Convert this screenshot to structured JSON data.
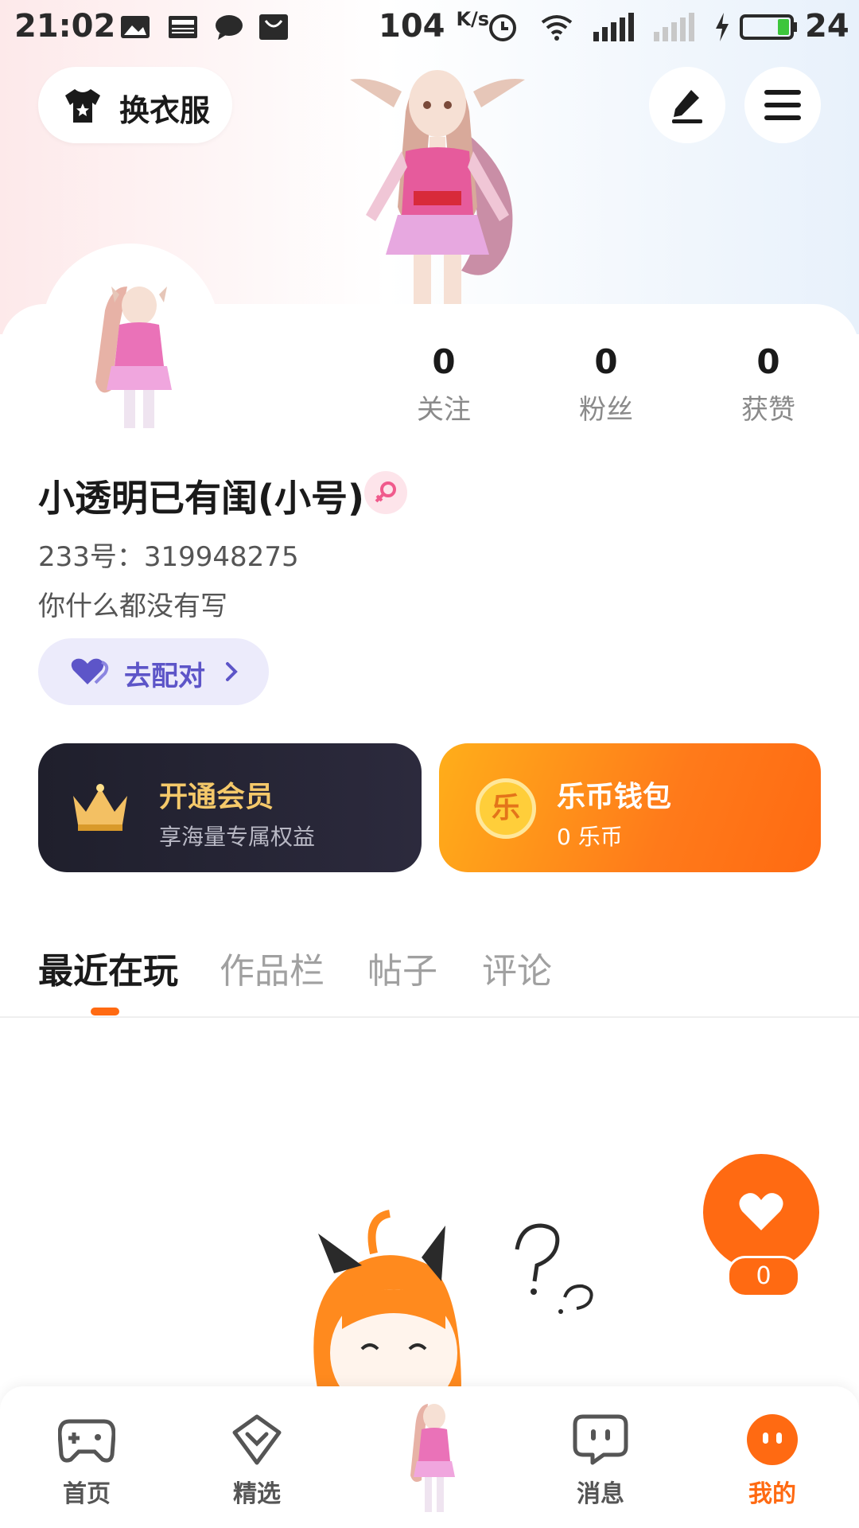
{
  "status_bar": {
    "time": "21:02",
    "speed": "104",
    "speed_unit": "K/s",
    "battery_pct": "24"
  },
  "header": {
    "change_outfit_label": "换衣服"
  },
  "profile": {
    "stats": [
      {
        "value": "0",
        "label": "关注"
      },
      {
        "value": "0",
        "label": "粉丝"
      },
      {
        "value": "0",
        "label": "获赞"
      }
    ],
    "username": "小透明已有闺(小号)",
    "uid": "233号：319948275",
    "bio": "你什么都没有写",
    "pair_button_label": "去配对"
  },
  "cards": {
    "vip": {
      "title": "开通会员",
      "subtitle": "享海量专属权益"
    },
    "wallet": {
      "title": "乐币钱包",
      "subtitle": "0 乐币",
      "coin_glyph": "乐"
    }
  },
  "tabs": [
    {
      "label": "最近在玩",
      "active": true
    },
    {
      "label": "作品栏",
      "active": false
    },
    {
      "label": "帖子",
      "active": false
    },
    {
      "label": "评论",
      "active": false
    }
  ],
  "like_fab": {
    "count": "0"
  },
  "bottom_nav": [
    {
      "label": "首页",
      "icon": "gamepad-icon"
    },
    {
      "label": "精选",
      "icon": "heart-shield-icon"
    },
    {
      "label": "消息",
      "icon": "chat-bubble-icon"
    },
    {
      "label": "我的",
      "icon": "profile-face-icon",
      "active": true
    }
  ],
  "colors": {
    "accent": "#ff6a12",
    "vip_gold": "#f5c96a",
    "pair_purple": "#5d55c8"
  }
}
